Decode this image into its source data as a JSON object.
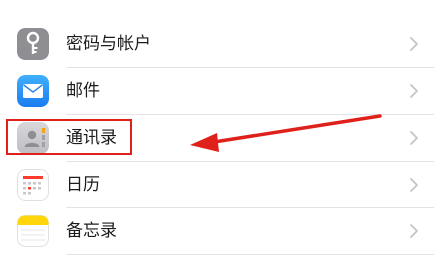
{
  "settings_list": {
    "items": [
      {
        "label": "密码与帐户",
        "icon": "key-icon"
      },
      {
        "label": "邮件",
        "icon": "mail-icon"
      },
      {
        "label": "通讯录",
        "icon": "contacts-icon"
      },
      {
        "label": "日历",
        "icon": "calendar-icon"
      },
      {
        "label": "备忘录",
        "icon": "notes-icon"
      }
    ]
  },
  "annotation": {
    "highlight_color": "#e0211b",
    "highlighted_item": "通讯录"
  },
  "colors": {
    "key_icon_bg": "#8e8e93",
    "mail_icon_bg": "#1a8cf5",
    "contacts_icon_bg": "#c9c9cc",
    "calendar_icon_bg": "#ffffff",
    "notes_icon_bg": "#ffd60a"
  }
}
